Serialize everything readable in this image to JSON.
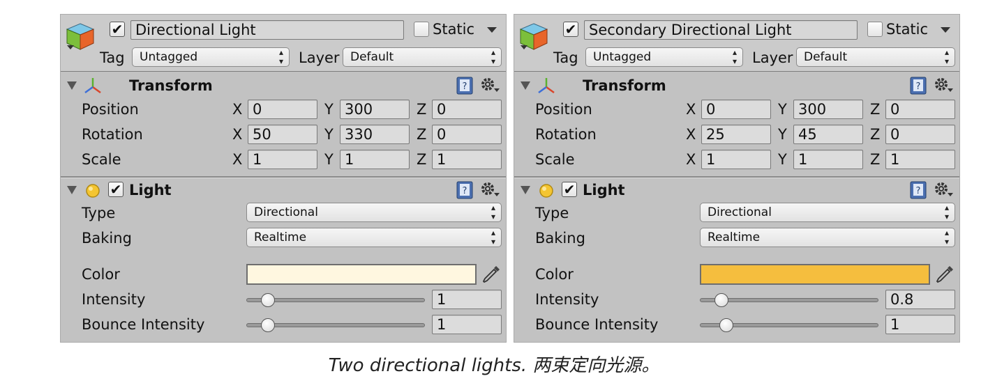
{
  "panels": [
    {
      "name": "Directional Light",
      "active": true,
      "static_label": "Static",
      "static_checked": false,
      "tag_label": "Tag",
      "tag_value": "Untagged",
      "layer_label": "Layer",
      "layer_value": "Default",
      "transform": {
        "title": "Transform",
        "rows": [
          {
            "label": "Position",
            "x": "0",
            "y": "300",
            "z": "0"
          },
          {
            "label": "Rotation",
            "x": "50",
            "y": "330",
            "z": "0"
          },
          {
            "label": "Scale",
            "x": "1",
            "y": "1",
            "z": "1"
          }
        ],
        "axis": {
          "x": "X",
          "y": "Y",
          "z": "Z"
        }
      },
      "light": {
        "title": "Light",
        "enabled": true,
        "type_label": "Type",
        "type_value": "Directional",
        "baking_label": "Baking",
        "baking_value": "Realtime",
        "color_label": "Color",
        "color_value": "#fff7e0",
        "intensity_label": "Intensity",
        "intensity_value": "0.8",
        "intensity_display": "1",
        "intensity_fraction": 0.12,
        "bounce_label": "Bounce Intensity",
        "bounce_value": "1",
        "bounce_fraction": 0.12
      }
    },
    {
      "name": "Secondary Directional Light",
      "active": true,
      "static_label": "Static",
      "static_checked": false,
      "tag_label": "Tag",
      "tag_value": "Untagged",
      "layer_label": "Layer",
      "layer_value": "Default",
      "transform": {
        "title": "Transform",
        "rows": [
          {
            "label": "Position",
            "x": "0",
            "y": "300",
            "z": "0"
          },
          {
            "label": "Rotation",
            "x": "25",
            "y": "45",
            "z": "0"
          },
          {
            "label": "Scale",
            "x": "1",
            "y": "1",
            "z": "1"
          }
        ],
        "axis": {
          "x": "X",
          "y": "Y",
          "z": "Z"
        }
      },
      "light": {
        "title": "Light",
        "enabled": true,
        "type_label": "Type",
        "type_value": "Directional",
        "baking_label": "Baking",
        "baking_value": "Realtime",
        "color_label": "Color",
        "color_value": "#f5be3e",
        "intensity_label": "Intensity",
        "intensity_value": "0.8",
        "intensity_display": "0.8",
        "intensity_fraction": 0.12,
        "bounce_label": "Bounce Intensity",
        "bounce_value": "1",
        "bounce_fraction": 0.15
      }
    }
  ],
  "icons": {
    "object": "gameobject-cube-icon",
    "transform": "transform-axes-icon",
    "light": "light-bulb-icon",
    "help": "help-book-icon",
    "gear": "gear-icon",
    "picker": "eyedropper-icon",
    "foldout": "foldout-triangle-icon"
  },
  "colors": {
    "panel_bg": "#c2c2c2",
    "header_bg": "#cbcbcb",
    "field_bg": "#dcdcdc"
  },
  "caption": "Two directional lights.  两束定向光源。"
}
